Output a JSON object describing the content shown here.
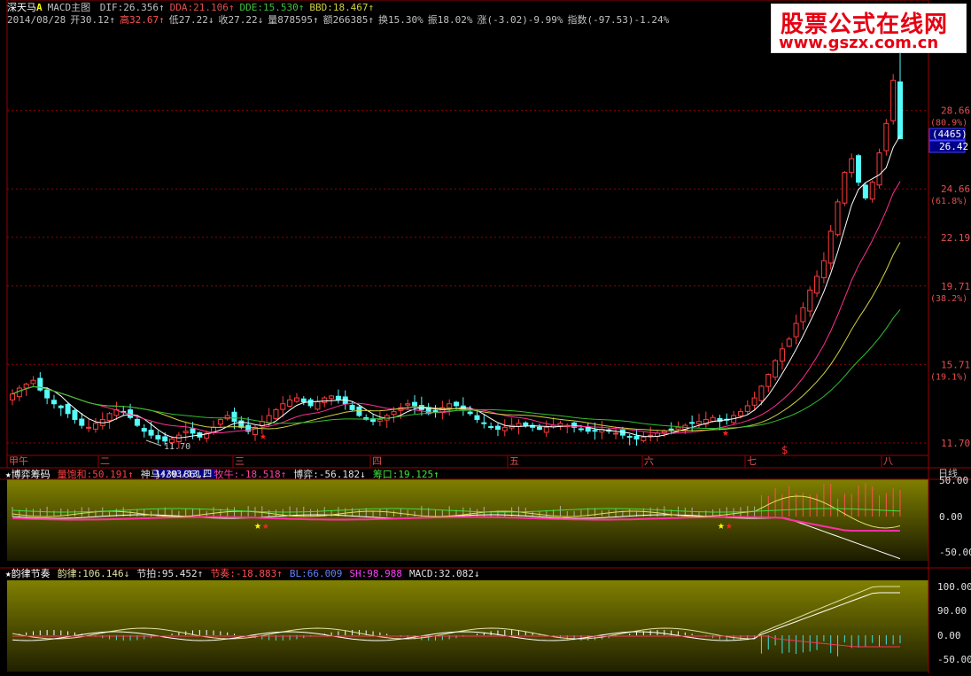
{
  "header": {
    "stock_name": "深天马",
    "stock_flag": "A",
    "indicator_title": "MACD主图",
    "values": [
      {
        "text": "DIF:26.356↑",
        "color": "#c0c0c0"
      },
      {
        "text": "DDA:21.106↑",
        "color": "#e05050"
      },
      {
        "text": "DDE:15.530↑",
        "color": "#40c040"
      },
      {
        "text": "BBD:18.467↑",
        "color": "#d0d040"
      }
    ],
    "quote_parts": [
      {
        "text": "2014/08/28",
        "color": "#c0c0c0"
      },
      {
        "text": "开30.12↑",
        "color": "#c0c0c0"
      },
      {
        "text": "高32.67↑",
        "color": "#ff5050"
      },
      {
        "text": "低27.22↓",
        "color": "#c0c0c0"
      },
      {
        "text": "收27.22↓",
        "color": "#c0c0c0"
      },
      {
        "text": "量878595↑",
        "color": "#c0c0c0"
      },
      {
        "text": "额266385↑",
        "color": "#c0c0c0"
      },
      {
        "text": "换15.30%",
        "color": "#c0c0c0"
      },
      {
        "text": "振18.02%",
        "color": "#c0c0c0"
      },
      {
        "text": "涨(-3.02)-9.99%",
        "color": "#c0c0c0"
      },
      {
        "text": "指数(-97.53)-1.24%",
        "color": "#c0c0c0"
      }
    ]
  },
  "watermark": {
    "title": "股票公式在线网",
    "url": "www.gszx.com.cn"
  },
  "price_axis": {
    "labels": [
      {
        "value": "28.66",
        "pct": "(80.9%)"
      },
      {
        "value": "24.66",
        "pct": "(61.8%)"
      },
      {
        "value": "22.19",
        "pct": ""
      },
      {
        "value": "19.71",
        "pct": "(38.2%)"
      },
      {
        "value": "15.71",
        "pct": "(19.1%)"
      },
      {
        "value": "11.70",
        "pct": ""
      }
    ],
    "count_badge": "(4465)",
    "current_price": "26.42",
    "low_marker": "11.70"
  },
  "time_axis": {
    "labels": [
      "甲午",
      "二",
      "三",
      "四",
      "五",
      "六",
      "七",
      "八"
    ],
    "cursor_date": "14/03/13,四",
    "period": "日线"
  },
  "panel2": {
    "title": "★博弈筹码",
    "values": [
      {
        "text": "量饱和:50.191↑",
        "color": "#ff4040"
      },
      {
        "text": "神马:39.861↓",
        "color": "#e0e0e0"
      },
      {
        "text": "牧牛:-18.518↑",
        "color": "#ff40a0"
      },
      {
        "text": "博弈:-56.182↓",
        "color": "#e0e0e0"
      },
      {
        "text": "筹口:19.125↑",
        "color": "#40e040"
      }
    ],
    "axis": [
      "50.00",
      "0.00",
      "-50.00"
    ]
  },
  "panel3": {
    "title": "★韵律节奏",
    "values": [
      {
        "text": "韵律:106.146↓",
        "color": "#e0e0a0"
      },
      {
        "text": "节拍:95.452↑",
        "color": "#e0e0e0"
      },
      {
        "text": "节奏:-18.883↑",
        "color": "#ff5050"
      },
      {
        "text": "BL:66.009",
        "color": "#6080ff"
      },
      {
        "text": "SH:98.988",
        "color": "#ff40ff"
      },
      {
        "text": "MACD:32.082↓",
        "color": "#e0e0e0"
      }
    ],
    "axis": [
      "100.00",
      "90.00",
      "0.00",
      "-50.00"
    ]
  },
  "chart_data": {
    "type": "candlestick",
    "symbol": "深天马",
    "period": "日线",
    "last_bar": {
      "date": "2014/08/28",
      "open": 30.12,
      "high": 32.67,
      "low": 27.22,
      "close": 27.22,
      "volume": 878595,
      "amount": 266385,
      "turnover_pct": 15.3,
      "amplitude_pct": 18.02,
      "change": -3.02,
      "change_pct": -9.99
    },
    "y_ticks": [
      11.7,
      15.71,
      19.71,
      22.19,
      24.66,
      28.66
    ],
    "ylim": [
      11.7,
      32.67
    ],
    "low_point": 11.7,
    "months": [
      "甲午",
      "二",
      "三",
      "四",
      "五",
      "六",
      "七",
      "八"
    ],
    "closes": [
      14.2,
      14.5,
      14.7,
      14.9,
      14.4,
      14.0,
      13.7,
      13.5,
      13.2,
      12.9,
      12.6,
      12.5,
      12.7,
      12.9,
      13.2,
      13.4,
      13.3,
      13.0,
      12.6,
      12.3,
      12.1,
      11.9,
      11.8,
      11.9,
      12.1,
      12.3,
      12.2,
      12.0,
      12.2,
      12.5,
      12.9,
      13.1,
      12.8,
      12.5,
      12.3,
      12.5,
      12.8,
      13.1,
      13.4,
      13.7,
      13.9,
      14.0,
      13.8,
      13.6,
      13.8,
      14.0,
      14.1,
      13.9,
      13.7,
      13.4,
      13.1,
      12.9,
      12.8,
      12.9,
      13.1,
      13.3,
      13.5,
      13.7,
      13.6,
      13.4,
      13.2,
      13.3,
      13.5,
      13.7,
      13.6,
      13.4,
      13.2,
      12.9,
      12.7,
      12.5,
      12.4,
      12.5,
      12.6,
      12.7,
      12.6,
      12.5,
      12.4,
      12.5,
      12.6,
      12.7,
      12.6,
      12.5,
      12.4,
      12.3,
      12.3,
      12.4,
      12.3,
      12.2,
      12.1,
      12.0,
      11.9,
      12.0,
      12.1,
      12.2,
      12.3,
      12.4,
      12.5,
      12.6,
      12.7,
      12.8,
      12.9,
      13.0,
      12.8,
      12.9,
      13.1,
      13.3,
      13.6,
      14.0,
      14.6,
      15.2,
      15.9,
      16.5,
      17.0,
      17.8,
      18.6,
      19.5,
      20.2,
      21.0,
      22.5,
      24.0,
      25.5,
      26.2,
      25.0,
      24.2,
      25.0,
      26.5,
      28.0,
      30.2,
      27.22
    ],
    "series": [
      {
        "name": "DIF",
        "value": 26.356
      },
      {
        "name": "DDA",
        "value": 21.106
      },
      {
        "name": "DDE",
        "value": 15.53
      },
      {
        "name": "BBD",
        "value": 18.467
      }
    ]
  },
  "colors": {
    "up": "#ff3c3c",
    "down": "#54fcfc",
    "grid": "#9a0000",
    "axis_text": "#e05050"
  }
}
